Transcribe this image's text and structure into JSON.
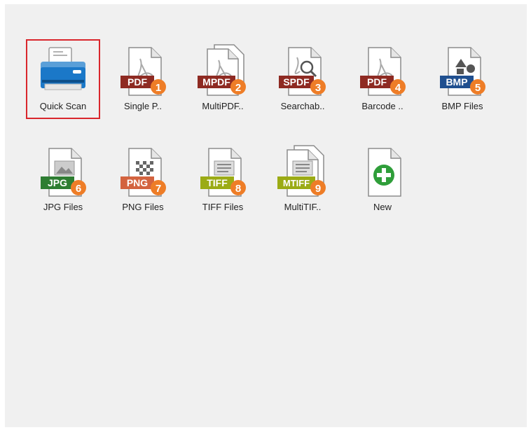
{
  "profiles": [
    {
      "label": "Quick Scan",
      "icon": "scanner-icon",
      "selected": true
    },
    {
      "label": "Single P..",
      "icon": "pdf-file-icon",
      "tag": "PDF",
      "num": "1",
      "tagColor": "#8e2a22"
    },
    {
      "label": "MultiPDF..",
      "icon": "multi-pdf-file-icon",
      "tag": "MPDF",
      "num": "2",
      "tagColor": "#8e2a22"
    },
    {
      "label": "Searchab..",
      "icon": "searchable-pdf-file-icon",
      "tag": "SPDF",
      "num": "3",
      "tagColor": "#8e2a22"
    },
    {
      "label": "Barcode ..",
      "icon": "barcode-pdf-file-icon",
      "tag": "PDF",
      "num": "4",
      "tagColor": "#8e2a22"
    },
    {
      "label": "BMP Files",
      "icon": "bmp-file-icon",
      "tag": "BMP",
      "num": "5",
      "tagColor": "#1f4f8f"
    },
    {
      "label": "JPG Files",
      "icon": "jpg-file-icon",
      "tag": "JPG",
      "num": "6",
      "tagColor": "#2e7d32"
    },
    {
      "label": "PNG Files",
      "icon": "png-file-icon",
      "tag": "PNG",
      "num": "7",
      "tagColor": "#d3633f"
    },
    {
      "label": "TIFF Files",
      "icon": "tiff-file-icon",
      "tag": "TIFF",
      "num": "8",
      "tagColor": "#9bab15"
    },
    {
      "label": "MultiTIF..",
      "icon": "multi-tiff-file-icon",
      "tag": "MTIFF",
      "num": "9",
      "tagColor": "#9bab15"
    },
    {
      "label": "New",
      "icon": "add-new-icon"
    }
  ],
  "colors": {
    "badge": "#ee7d27",
    "selection": "#d9262c",
    "scanner": "#1b78c8",
    "add": "#2f9e3a"
  }
}
